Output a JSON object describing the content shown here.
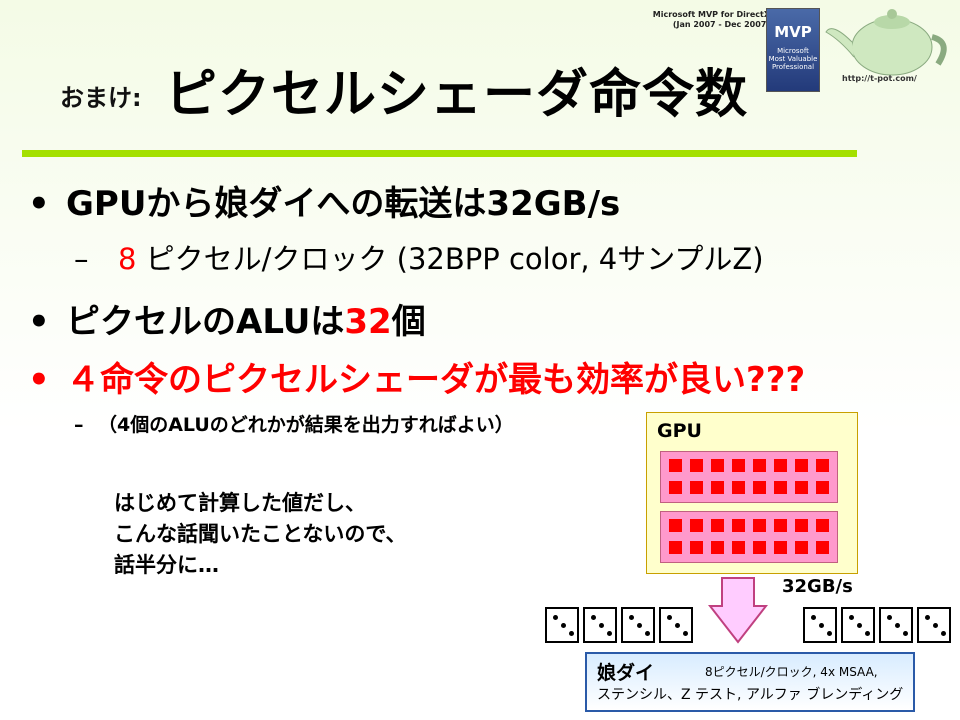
{
  "header": {
    "mvp_line1": "Microsoft MVP for DirectX",
    "mvp_line2": "(Jan 2007 - Dec 2007)",
    "mvp_badge": "MVP",
    "mvp_badge_sub": "Microsoft\nMost Valuable\nProfessional",
    "teapot_url": "http://t-pot.com/",
    "title_prefix": "おまけ:",
    "title": "ピクセルシェーダ命令数"
  },
  "bullets": {
    "b1": "GPUから娘ダイへの転送は32GB/s",
    "s1_num": "8",
    "s1_rest": " ピクセル/クロック (32BPP color, 4サンプルZ)",
    "b2_pre": "ピクセルのALUは",
    "b2_num": "32",
    "b2_post": "個",
    "b3": "４命令のピクセルシェーダが最も効率が良い???",
    "s3": "（4個のALUのどれかが結果を出力すればよい）"
  },
  "note": {
    "line1": "はじめて計算した値だし、",
    "line2": "こんな話聞いたことないので、",
    "line3": "話半分に…"
  },
  "diagram": {
    "gpu_label": "GPU",
    "bandwidth": "32GB/s",
    "daughter_title": "娘ダイ",
    "daughter_line1": "8ピクセル/クロック, 4x MSAA,",
    "daughter_line2": "ステンシル、Z テスト, アルファ ブレンディング"
  }
}
